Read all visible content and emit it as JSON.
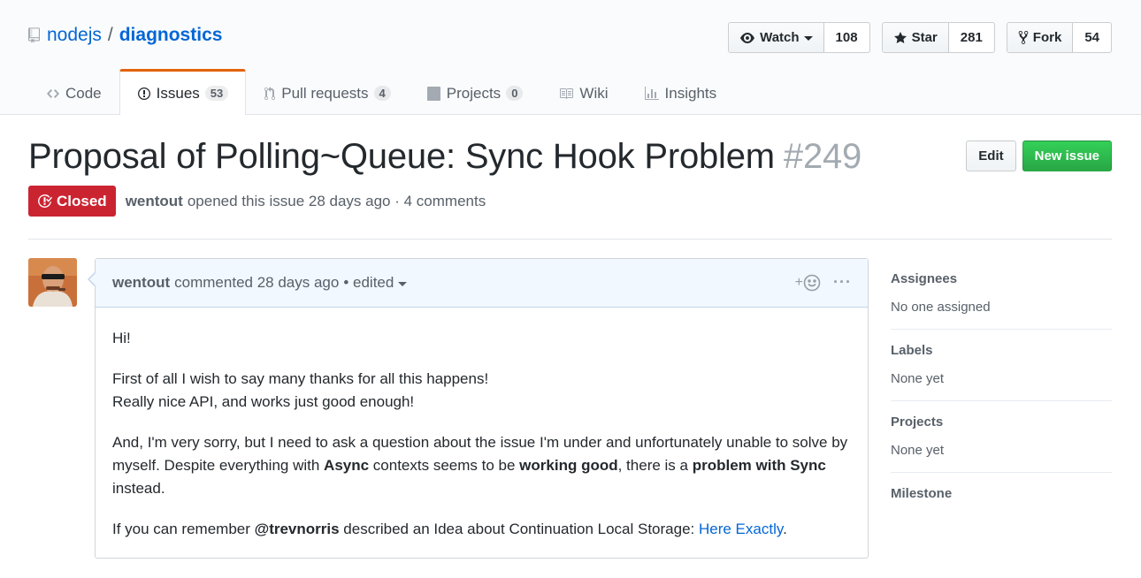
{
  "repo": {
    "owner": "nodejs",
    "separator": "/",
    "name": "diagnostics",
    "icon": "repo-icon"
  },
  "actions": {
    "watch": {
      "label": "Watch",
      "count": "108",
      "icon": "eye-icon"
    },
    "star": {
      "label": "Star",
      "count": "281",
      "icon": "star-icon"
    },
    "fork": {
      "label": "Fork",
      "count": "54",
      "icon": "fork-icon"
    }
  },
  "nav": {
    "code": {
      "label": "Code",
      "icon": "code-icon"
    },
    "issues": {
      "label": "Issues",
      "count": "53",
      "icon": "issue-opened-icon"
    },
    "pulls": {
      "label": "Pull requests",
      "count": "4",
      "icon": "git-pull-request-icon"
    },
    "projects": {
      "label": "Projects",
      "count": "0",
      "icon": "project-icon"
    },
    "wiki": {
      "label": "Wiki",
      "icon": "book-icon"
    },
    "insights": {
      "label": "Insights",
      "icon": "graph-icon"
    }
  },
  "issue": {
    "title": "Proposal of Polling~Queue: Sync Hook Problem",
    "number": "#249",
    "state": "Closed",
    "author": "wentout",
    "opened_text": "opened this issue 28 days ago · 4 comments",
    "edit_label": "Edit",
    "new_issue_label": "New issue"
  },
  "comment": {
    "author": "wentout",
    "meta": "commented 28 days ago",
    "edited": "• edited",
    "reaction": "+",
    "more": "···",
    "body": {
      "p1": "Hi!",
      "p2_line1": "First of all I wish to say many thanks for all this happens!",
      "p2_line2": "Really nice API, and works just good enough!",
      "p3_a": "And, I'm very sorry, but I need to ask a question about the issue I'm under and unfortunately unable to solve by myself. Despite everything with ",
      "p3_b": "Async",
      "p3_c": " contexts seems to be ",
      "p3_d": "working good",
      "p3_e": ", there is a ",
      "p3_f": "problem with Sync",
      "p3_g": " instead.",
      "p4_a": "If you can remember ",
      "p4_b": "@trevnorris",
      "p4_c": " described an Idea about Continuation Local Storage: ",
      "p4_link": "Here Exactly",
      "p4_d": "."
    }
  },
  "sidebar": {
    "assignees": {
      "heading": "Assignees",
      "value": "No one assigned"
    },
    "labels": {
      "heading": "Labels",
      "value": "None yet"
    },
    "projects": {
      "heading": "Projects",
      "value": "None yet"
    },
    "milestone": {
      "heading": "Milestone"
    }
  },
  "colors": {
    "link": "#0366d6",
    "closed": "#cb2431",
    "new_issue": "#28a745",
    "tab_accent": "#e36209"
  }
}
